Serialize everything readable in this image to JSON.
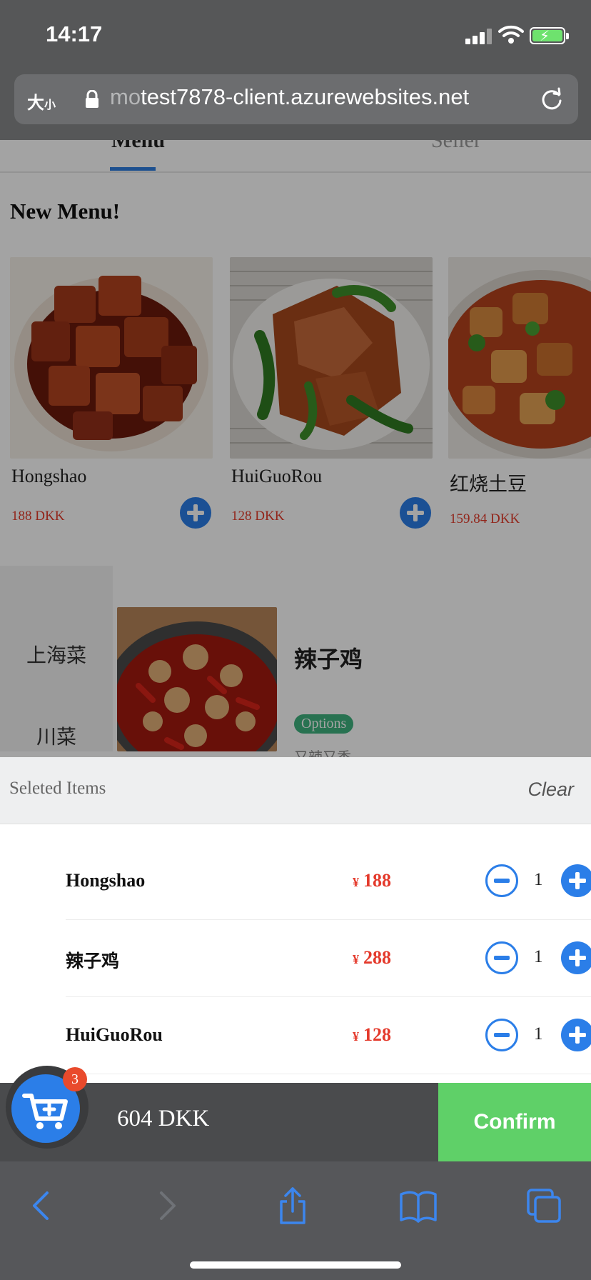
{
  "status_bar": {
    "time": "14:17"
  },
  "browser": {
    "text_size_label_big": "大",
    "text_size_label_small": "小",
    "url_visible_prefix": "mo",
    "url_rest": "test7878-client.azurewebsites.net"
  },
  "tabs": [
    {
      "label": "Menu"
    },
    {
      "label": "Seller"
    }
  ],
  "new_menu": {
    "title": "New Menu!",
    "items": [
      {
        "name": "Hongshao",
        "price": "188 DKK"
      },
      {
        "name": "HuiGuoRou",
        "price": "128 DKK"
      },
      {
        "name": "红烧土豆",
        "price": "159.84 DKK"
      }
    ]
  },
  "categories": [
    {
      "label": "上海菜"
    },
    {
      "label": "川菜"
    }
  ],
  "dish": {
    "name": "辣子鸡",
    "options": "Options",
    "desc": "又辣又香"
  },
  "selected": {
    "title": "Seleted Items",
    "clear": "Clear",
    "currency_symbol": "¥",
    "items": [
      {
        "name": "Hongshao",
        "price": "188",
        "qty": "1"
      },
      {
        "name": "辣子鸡",
        "price": "288",
        "qty": "1"
      },
      {
        "name": "HuiGuoRou",
        "price": "128",
        "qty": "1"
      }
    ]
  },
  "cart": {
    "badge": "3",
    "total": "604 DKK",
    "confirm": "Confirm"
  },
  "colors": {
    "accent": "#2b7ee8",
    "price": "#e4392b",
    "confirm": "#5fd068",
    "badge": "#e94a2c"
  }
}
